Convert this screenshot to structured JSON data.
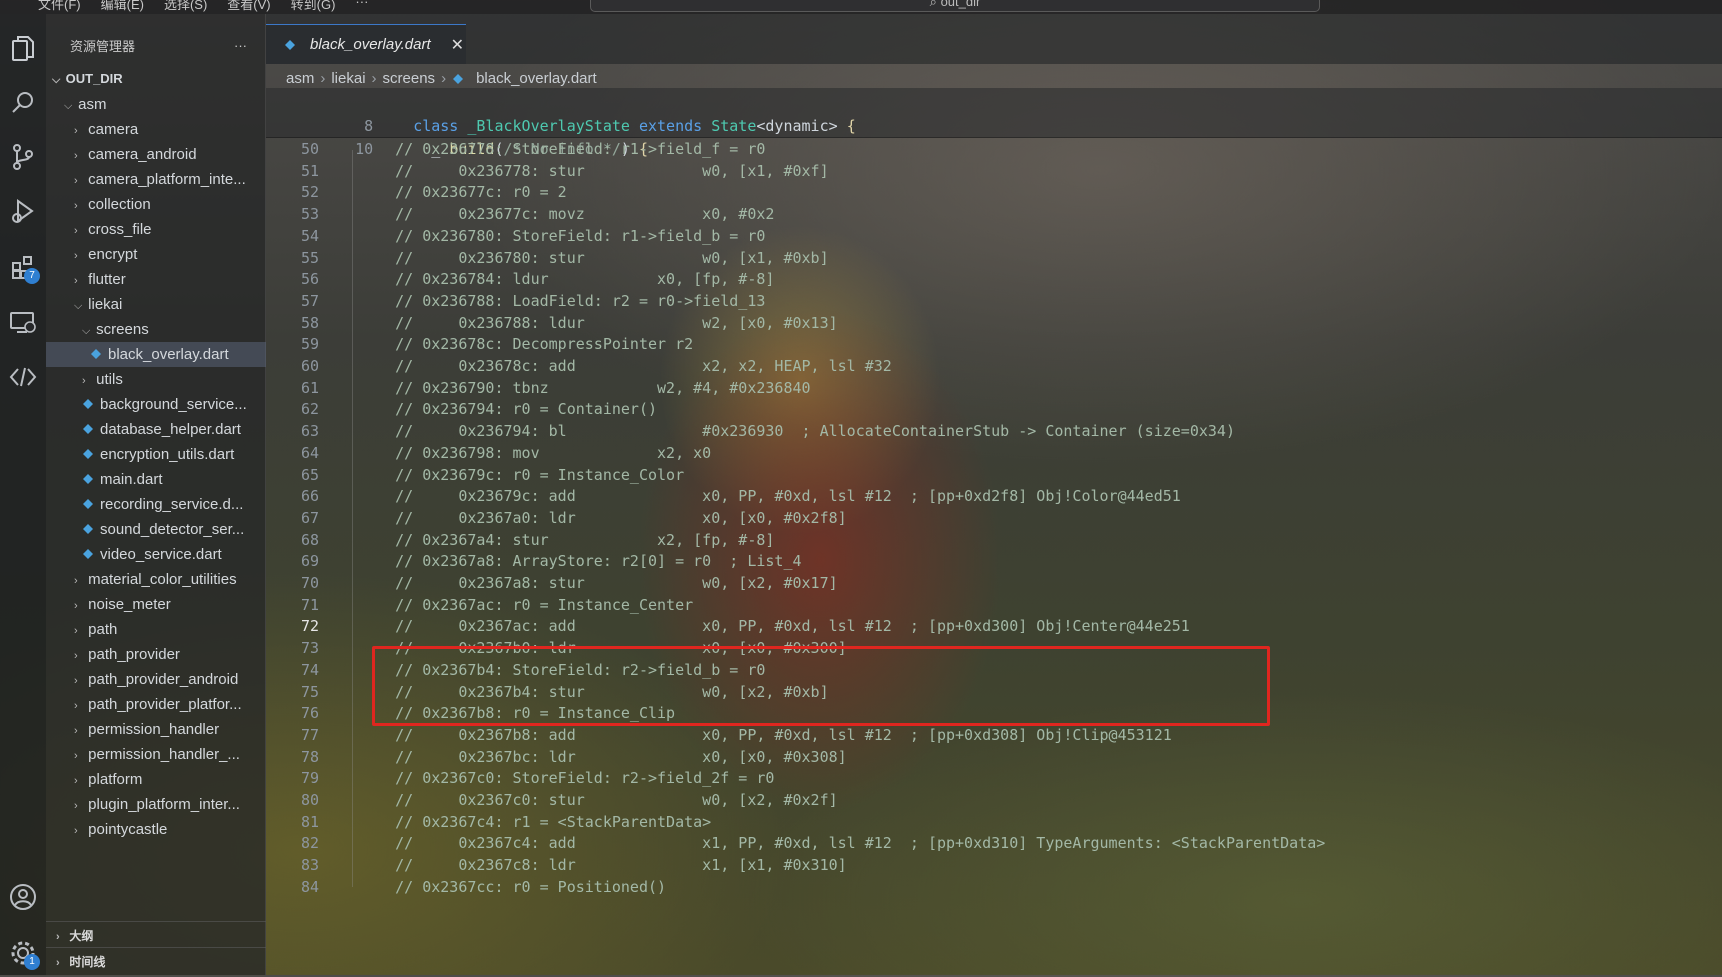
{
  "titlebar": {
    "menu": [
      "文件(F)",
      "编辑(E)",
      "选择(S)",
      "查看(V)",
      "转到(G)",
      "···"
    ],
    "search_text": "out_dir"
  },
  "activity": {
    "extensions_badge": "7",
    "settings_badge": "1"
  },
  "sidebar": {
    "title": "资源管理器",
    "more": "···",
    "root": "OUT_DIR",
    "items": [
      {
        "label": "asm",
        "depth": 1,
        "kind": "folder-open"
      },
      {
        "label": "camera",
        "depth": 2,
        "kind": "folder"
      },
      {
        "label": "camera_android",
        "depth": 2,
        "kind": "folder"
      },
      {
        "label": "camera_platform_inte...",
        "depth": 2,
        "kind": "folder"
      },
      {
        "label": "collection",
        "depth": 2,
        "kind": "folder"
      },
      {
        "label": "cross_file",
        "depth": 2,
        "kind": "folder"
      },
      {
        "label": "encrypt",
        "depth": 2,
        "kind": "folder"
      },
      {
        "label": "flutter",
        "depth": 2,
        "kind": "folder"
      },
      {
        "label": "liekai",
        "depth": 2,
        "kind": "folder-open"
      },
      {
        "label": "screens",
        "depth": 3,
        "kind": "folder-open"
      },
      {
        "label": "black_overlay.dart",
        "depth": 4,
        "kind": "file",
        "selected": true
      },
      {
        "label": "utils",
        "depth": 3,
        "kind": "folder"
      },
      {
        "label": "background_service...",
        "depth": 3,
        "kind": "file"
      },
      {
        "label": "database_helper.dart",
        "depth": 3,
        "kind": "file"
      },
      {
        "label": "encryption_utils.dart",
        "depth": 3,
        "kind": "file"
      },
      {
        "label": "main.dart",
        "depth": 3,
        "kind": "file"
      },
      {
        "label": "recording_service.d...",
        "depth": 3,
        "kind": "file"
      },
      {
        "label": "sound_detector_ser...",
        "depth": 3,
        "kind": "file"
      },
      {
        "label": "video_service.dart",
        "depth": 3,
        "kind": "file"
      },
      {
        "label": "material_color_utilities",
        "depth": 2,
        "kind": "folder"
      },
      {
        "label": "noise_meter",
        "depth": 2,
        "kind": "folder"
      },
      {
        "label": "path",
        "depth": 2,
        "kind": "folder"
      },
      {
        "label": "path_provider",
        "depth": 2,
        "kind": "folder"
      },
      {
        "label": "path_provider_android",
        "depth": 2,
        "kind": "folder"
      },
      {
        "label": "path_provider_platfor...",
        "depth": 2,
        "kind": "folder"
      },
      {
        "label": "permission_handler",
        "depth": 2,
        "kind": "folder"
      },
      {
        "label": "permission_handler_...",
        "depth": 2,
        "kind": "folder"
      },
      {
        "label": "platform",
        "depth": 2,
        "kind": "folder"
      },
      {
        "label": "plugin_platform_inter...",
        "depth": 2,
        "kind": "folder"
      },
      {
        "label": "pointycastle",
        "depth": 2,
        "kind": "folder"
      }
    ],
    "outline": "大纲",
    "timeline": "时间线"
  },
  "tab": {
    "label": "black_overlay.dart",
    "close": "✕"
  },
  "breadcrumb": [
    "asm",
    "liekai",
    "screens",
    "black_overlay.dart"
  ],
  "sticky": [
    {
      "n": "8",
      "text": "class _BlackOverlayState extends State<dynamic> {"
    },
    {
      "n": "10",
      "text": "  _ build(/* No info */) {"
    }
  ],
  "current_line": "72",
  "code": [
    {
      "n": "50",
      "text": "    // 0x236778: StoreField: r1->field_f = r0"
    },
    {
      "n": "51",
      "text": "    //     0x236778: stur             w0, [x1, #0xf]"
    },
    {
      "n": "52",
      "text": "    // 0x23677c: r0 = 2"
    },
    {
      "n": "53",
      "text": "    //     0x23677c: movz             x0, #0x2"
    },
    {
      "n": "54",
      "text": "    // 0x236780: StoreField: r1->field_b = r0"
    },
    {
      "n": "55",
      "text": "    //     0x236780: stur             w0, [x1, #0xb]"
    },
    {
      "n": "56",
      "text": "    // 0x236784: ldur            x0, [fp, #-8]"
    },
    {
      "n": "57",
      "text": "    // 0x236788: LoadField: r2 = r0->field_13"
    },
    {
      "n": "58",
      "text": "    //     0x236788: ldur             w2, [x0, #0x13]"
    },
    {
      "n": "59",
      "text": "    // 0x23678c: DecompressPointer r2"
    },
    {
      "n": "60",
      "text": "    //     0x23678c: add              x2, x2, HEAP, lsl #32"
    },
    {
      "n": "61",
      "text": "    // 0x236790: tbnz            w2, #4, #0x236840"
    },
    {
      "n": "62",
      "text": "    // 0x236794: r0 = Container()"
    },
    {
      "n": "63",
      "text": "    //     0x236794: bl               #0x236930  ; AllocateContainerStub -> Container (size=0x34)"
    },
    {
      "n": "64",
      "text": "    // 0x236798: mov             x2, x0"
    },
    {
      "n": "65",
      "text": "    // 0x23679c: r0 = Instance_Color"
    },
    {
      "n": "66",
      "text": "    //     0x23679c: add              x0, PP, #0xd, lsl #12  ; [pp+0xd2f8] Obj!Color@44ed51"
    },
    {
      "n": "67",
      "text": "    //     0x2367a0: ldr              x0, [x0, #0x2f8]"
    },
    {
      "n": "68",
      "text": "    // 0x2367a4: stur            x2, [fp, #-8]"
    },
    {
      "n": "69",
      "text": "    // 0x2367a8: ArrayStore: r2[0] = r0  ; List_4"
    },
    {
      "n": "70",
      "text": "    //     0x2367a8: stur             w0, [x2, #0x17]"
    },
    {
      "n": "71",
      "text": "    // 0x2367ac: r0 = Instance_Center"
    },
    {
      "n": "72",
      "text": "    //     0x2367ac: add              x0, PP, #0xd, lsl #12  ; [pp+0xd300] Obj!Center@44e251"
    },
    {
      "n": "73",
      "text": "    //     0x2367b0: ldr              x0, [x0, #0x300]"
    },
    {
      "n": "74",
      "text": "    // 0x2367b4: StoreField: r2->field_b = r0"
    },
    {
      "n": "75",
      "text": "    //     0x2367b4: stur             w0, [x2, #0xb]"
    },
    {
      "n": "76",
      "text": "    // 0x2367b8: r0 = Instance_Clip"
    },
    {
      "n": "77",
      "text": "    //     0x2367b8: add              x0, PP, #0xd, lsl #12  ; [pp+0xd308] Obj!Clip@453121"
    },
    {
      "n": "78",
      "text": "    //     0x2367bc: ldr              x0, [x0, #0x308]"
    },
    {
      "n": "79",
      "text": "    // 0x2367c0: StoreField: r2->field_2f = r0"
    },
    {
      "n": "80",
      "text": "    //     0x2367c0: stur             w0, [x2, #0x2f]"
    },
    {
      "n": "81",
      "text": "    // 0x2367c4: r1 = <StackParentData>"
    },
    {
      "n": "82",
      "text": "    //     0x2367c4: add              x1, PP, #0xd, lsl #12  ; [pp+0xd310] TypeArguments: <StackParentData>"
    },
    {
      "n": "83",
      "text": "    //     0x2367c8: ldr              x1, [x1, #0x310]"
    },
    {
      "n": "84",
      "text": "    // 0x2367cc: r0 = Positioned()"
    }
  ]
}
